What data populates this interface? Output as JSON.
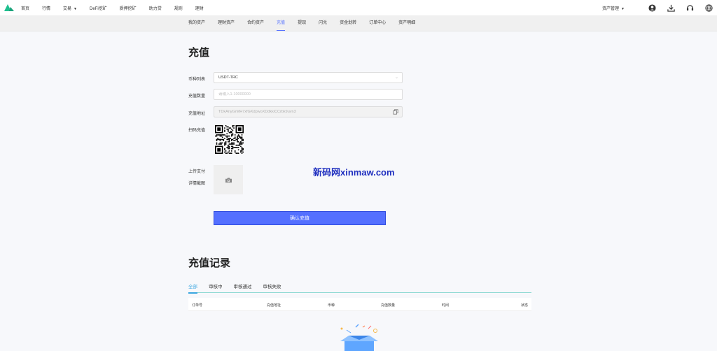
{
  "nav": {
    "items": [
      {
        "label": "首页"
      },
      {
        "label": "行情"
      },
      {
        "label": "交易",
        "dropdown": true
      },
      {
        "label": "DeFi挖矿"
      },
      {
        "label": "质押挖矿"
      },
      {
        "label": "助力贷"
      },
      {
        "label": "规则"
      },
      {
        "label": "理财"
      }
    ],
    "asset_menu": "资产管理"
  },
  "subnav": {
    "items": [
      {
        "label": "我的资产",
        "active": false
      },
      {
        "label": "理财资产",
        "active": false
      },
      {
        "label": "合约资产",
        "active": false
      },
      {
        "label": "充值",
        "active": true
      },
      {
        "label": "提现",
        "active": false
      },
      {
        "label": "闪兑",
        "active": false
      },
      {
        "label": "资金划转",
        "active": false
      },
      {
        "label": "订单中心",
        "active": false
      },
      {
        "label": "资产明细",
        "active": false
      }
    ]
  },
  "form": {
    "title": "充值",
    "coin_label": "币种列表",
    "coin_value": "USDT-TRC",
    "amount_label": "充值数量",
    "amount_placeholder": "请输入1-10000000",
    "address_label": "充值地址",
    "address_value": "TDkAnyGrMH7xfGKdpwoXDdkkiCCrbk9uvn3",
    "qr_label": "扫码充值",
    "upload_label_1": "上传支付",
    "upload_label_2": "详情截图",
    "submit_label": "确认充值"
  },
  "watermark": "新码网xinmaw.com",
  "records": {
    "title": "充值记录",
    "tabs": [
      {
        "label": "全部",
        "active": true
      },
      {
        "label": "审核中",
        "active": false
      },
      {
        "label": "审核通过",
        "active": false
      },
      {
        "label": "审核失败",
        "active": false
      }
    ],
    "columns": [
      "订单号",
      "充值地址",
      "币种",
      "充值数量",
      "时间",
      "状态"
    ]
  },
  "colors": {
    "accent": "#5470ff",
    "tab_active": "#3aa6e0",
    "watermark": "#1f2fbf"
  }
}
